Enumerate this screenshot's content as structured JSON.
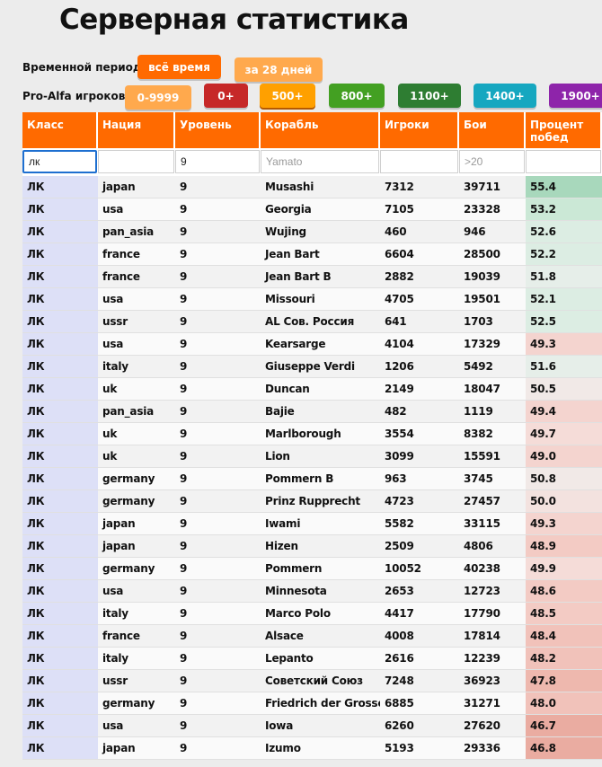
{
  "page": {
    "title": "Серверная статистика"
  },
  "period": {
    "label": "Временной период:",
    "options": [
      "всё время",
      "за 28 дней"
    ],
    "active_index": 0
  },
  "players_filter": {
    "label": "Pro-Alfa игроков:",
    "options": [
      {
        "label": "0-9999",
        "color": "#ffa94d"
      },
      {
        "label": "0+",
        "color": "#c62828"
      },
      {
        "label": "500+",
        "color": "#ffa000"
      },
      {
        "label": "800+",
        "color": "#43a022"
      },
      {
        "label": "1100+",
        "color": "#2e7d32"
      },
      {
        "label": "1400+",
        "color": "#16a7c0"
      },
      {
        "label": "1900+",
        "color": "#8e24aa"
      }
    ]
  },
  "table": {
    "header_color": "#ff6a00",
    "class_column_color": "#dde0f7",
    "columns": [
      "Класс",
      "Нация",
      "Уровень",
      "Корабль",
      "Игроки",
      "Бои",
      "Процент побед"
    ],
    "filters": [
      {
        "value": "лк",
        "placeholder": ""
      },
      {
        "value": "",
        "placeholder": ""
      },
      {
        "value": "9",
        "placeholder": ""
      },
      {
        "value": "",
        "placeholder": "Yamato"
      },
      {
        "value": "",
        "placeholder": ""
      },
      {
        "value": "",
        "placeholder": ">20"
      },
      {
        "value": "",
        "placeholder": ""
      }
    ],
    "rows": [
      {
        "cls": "ЛК",
        "nation": "japan",
        "tier": "9",
        "ship": "Musashi",
        "players": "7312",
        "battles": "39711",
        "winrate": "55.4"
      },
      {
        "cls": "ЛК",
        "nation": "usa",
        "tier": "9",
        "ship": "Georgia",
        "players": "7105",
        "battles": "23328",
        "winrate": "53.2"
      },
      {
        "cls": "ЛК",
        "nation": "pan_asia",
        "tier": "9",
        "ship": "Wujing",
        "players": "460",
        "battles": "946",
        "winrate": "52.6"
      },
      {
        "cls": "ЛК",
        "nation": "france",
        "tier": "9",
        "ship": "Jean Bart",
        "players": "6604",
        "battles": "28500",
        "winrate": "52.2"
      },
      {
        "cls": "ЛК",
        "nation": "france",
        "tier": "9",
        "ship": "Jean Bart B",
        "players": "2882",
        "battles": "19039",
        "winrate": "51.8"
      },
      {
        "cls": "ЛК",
        "nation": "usa",
        "tier": "9",
        "ship": "Missouri",
        "players": "4705",
        "battles": "19501",
        "winrate": "52.1"
      },
      {
        "cls": "ЛК",
        "nation": "ussr",
        "tier": "9",
        "ship": "AL Сов. Россия",
        "players": "641",
        "battles": "1703",
        "winrate": "52.5"
      },
      {
        "cls": "ЛК",
        "nation": "usa",
        "tier": "9",
        "ship": "Kearsarge",
        "players": "4104",
        "battles": "17329",
        "winrate": "49.3"
      },
      {
        "cls": "ЛК",
        "nation": "italy",
        "tier": "9",
        "ship": "Giuseppe Verdi",
        "players": "1206",
        "battles": "5492",
        "winrate": "51.6"
      },
      {
        "cls": "ЛК",
        "nation": "uk",
        "tier": "9",
        "ship": "Duncan",
        "players": "2149",
        "battles": "18047",
        "winrate": "50.5"
      },
      {
        "cls": "ЛК",
        "nation": "pan_asia",
        "tier": "9",
        "ship": "Bajie",
        "players": "482",
        "battles": "1119",
        "winrate": "49.4"
      },
      {
        "cls": "ЛК",
        "nation": "uk",
        "tier": "9",
        "ship": "Marlborough",
        "players": "3554",
        "battles": "8382",
        "winrate": "49.7"
      },
      {
        "cls": "ЛК",
        "nation": "uk",
        "tier": "9",
        "ship": "Lion",
        "players": "3099",
        "battles": "15591",
        "winrate": "49.0"
      },
      {
        "cls": "ЛК",
        "nation": "germany",
        "tier": "9",
        "ship": "Pommern B",
        "players": "963",
        "battles": "3745",
        "winrate": "50.8"
      },
      {
        "cls": "ЛК",
        "nation": "germany",
        "tier": "9",
        "ship": "Prinz Rupprecht",
        "players": "4723",
        "battles": "27457",
        "winrate": "50.0"
      },
      {
        "cls": "ЛК",
        "nation": "japan",
        "tier": "9",
        "ship": "Iwami",
        "players": "5582",
        "battles": "33115",
        "winrate": "49.3"
      },
      {
        "cls": "ЛК",
        "nation": "japan",
        "tier": "9",
        "ship": "Hizen",
        "players": "2509",
        "battles": "4806",
        "winrate": "48.9"
      },
      {
        "cls": "ЛК",
        "nation": "germany",
        "tier": "9",
        "ship": "Pommern",
        "players": "10052",
        "battles": "40238",
        "winrate": "49.9"
      },
      {
        "cls": "ЛК",
        "nation": "usa",
        "tier": "9",
        "ship": "Minnesota",
        "players": "2653",
        "battles": "12723",
        "winrate": "48.6"
      },
      {
        "cls": "ЛК",
        "nation": "italy",
        "tier": "9",
        "ship": "Marco Polo",
        "players": "4417",
        "battles": "17790",
        "winrate": "48.5"
      },
      {
        "cls": "ЛК",
        "nation": "france",
        "tier": "9",
        "ship": "Alsace",
        "players": "4008",
        "battles": "17814",
        "winrate": "48.4"
      },
      {
        "cls": "ЛК",
        "nation": "italy",
        "tier": "9",
        "ship": "Lepanto",
        "players": "2616",
        "battles": "12239",
        "winrate": "48.2"
      },
      {
        "cls": "ЛК",
        "nation": "ussr",
        "tier": "9",
        "ship": "Советский Союз",
        "players": "7248",
        "battles": "36923",
        "winrate": "47.8"
      },
      {
        "cls": "ЛК",
        "nation": "germany",
        "tier": "9",
        "ship": "Friedrich der Grosse",
        "players": "6885",
        "battles": "31271",
        "winrate": "48.0"
      },
      {
        "cls": "ЛК",
        "nation": "usa",
        "tier": "9",
        "ship": "Iowa",
        "players": "6260",
        "battles": "27620",
        "winrate": "46.7"
      },
      {
        "cls": "ЛК",
        "nation": "japan",
        "tier": "9",
        "ship": "Izumo",
        "players": "5193",
        "battles": "29336",
        "winrate": "46.8"
      }
    ]
  }
}
